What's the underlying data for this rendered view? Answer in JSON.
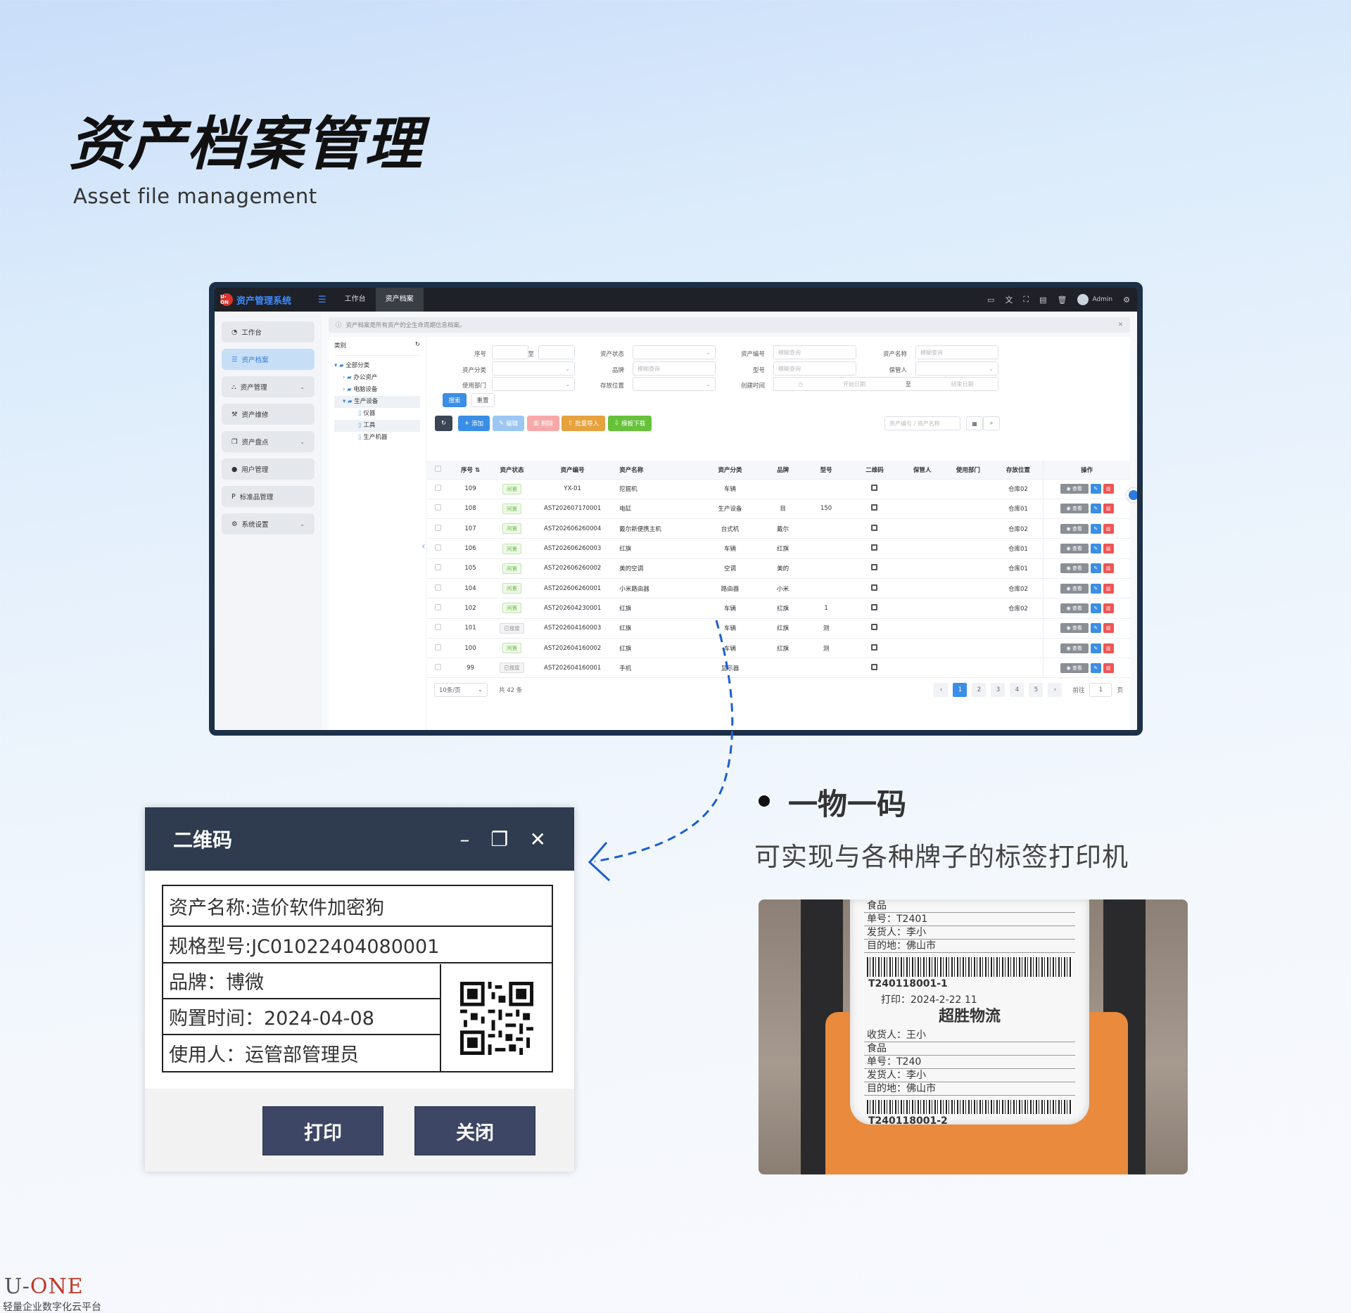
{
  "hero": {
    "title": "资产档案管理",
    "subtitle": "Asset file management"
  },
  "app": {
    "brand_logo": "U-ON",
    "brand_name": "资产管理系统",
    "tabs": [
      "工作台",
      "资产档案"
    ],
    "user": "Admin",
    "sidebar": [
      {
        "label": "工作台",
        "icon": "dashboard-icon"
      },
      {
        "label": "资产档案",
        "icon": "list-icon",
        "active": true
      },
      {
        "label": "资产管理",
        "icon": "sitemap-icon"
      },
      {
        "label": "资产维修",
        "icon": "hammer-icon"
      },
      {
        "label": "资产盘点",
        "icon": "copy-icon"
      },
      {
        "label": "用户管理",
        "icon": "user-icon"
      },
      {
        "label": "标准品管理",
        "icon": "p-icon"
      },
      {
        "label": "系统设置",
        "icon": "gears-icon"
      }
    ],
    "notice": "资产档案是所有资产的全生命周期信息档案。",
    "tree": {
      "header": "类别",
      "nodes": [
        "全部分类",
        "办公资产",
        "电脑设备",
        "生产设备",
        "仪器",
        "工具",
        "生产机器"
      ]
    },
    "filters": {
      "seq_label": "序号",
      "to": "至",
      "status_label": "资产状态",
      "code_label": "资产编号",
      "code_ph": "模糊查询",
      "name_label": "资产名称",
      "name_ph": "模糊查询",
      "category_label": "资产分类",
      "brand_label": "品牌",
      "brand_ph": "模糊查询",
      "model_label": "型号",
      "model_ph": "模糊查询",
      "keeper_label": "保管人",
      "dept_label": "使用部门",
      "location_label": "存放位置",
      "created_label": "创建时间",
      "start_ph": "开始日期",
      "end_ph": "结束日期",
      "range_sep": "至",
      "search_btn": "搜索",
      "reset_btn": "重置"
    },
    "toolbar": {
      "add": "添加",
      "edit": "编辑",
      "delete": "删除",
      "import": "批量导入",
      "template": "模板下载",
      "search_ph": "资产编号 / 资产名称"
    },
    "columns": [
      "序号",
      "资产状态",
      "资产编号",
      "资产名称",
      "资产分类",
      "品牌",
      "型号",
      "二维码",
      "保管人",
      "使用部门",
      "存放位置",
      "操作"
    ],
    "rows": [
      {
        "seq": "109",
        "status": "闲置",
        "code": "YX-01",
        "name": "挖掘机",
        "cat": "车辆",
        "brand": "",
        "model": "",
        "loc": "仓库02"
      },
      {
        "seq": "108",
        "status": "闲置",
        "code": "AST202607170001",
        "name": "电缸",
        "cat": "生产设备",
        "brand": "目",
        "model": "150",
        "loc": "仓库01"
      },
      {
        "seq": "107",
        "status": "闲置",
        "code": "AST202606260004",
        "name": "戴尔新便携主机",
        "cat": "台式机",
        "brand": "戴尔",
        "model": "",
        "loc": "仓库02"
      },
      {
        "seq": "106",
        "status": "闲置",
        "code": "AST202606260003",
        "name": "红旗",
        "cat": "车辆",
        "brand": "红旗",
        "model": "",
        "loc": "仓库01"
      },
      {
        "seq": "105",
        "status": "闲置",
        "code": "AST202606260002",
        "name": "美的空调",
        "cat": "空调",
        "brand": "美的",
        "model": "",
        "loc": "仓库01"
      },
      {
        "seq": "104",
        "status": "闲置",
        "code": "AST202606260001",
        "name": "小米路由器",
        "cat": "路由器",
        "brand": "小米",
        "model": "",
        "loc": "仓库02"
      },
      {
        "seq": "102",
        "status": "闲置",
        "code": "AST202604230001",
        "name": "红旗",
        "cat": "车辆",
        "brand": "红旗",
        "model": "1",
        "loc": "仓库02"
      },
      {
        "seq": "101",
        "status": "已报废",
        "code": "AST202604160003",
        "name": "红旗",
        "cat": "车辆",
        "brand": "红旗",
        "model": "测",
        "loc": ""
      },
      {
        "seq": "100",
        "status": "闲置",
        "code": "AST202604160002",
        "name": "红旗",
        "cat": "车辆",
        "brand": "红旗",
        "model": "测",
        "loc": ""
      },
      {
        "seq": "99",
        "status": "已报废",
        "code": "AST202604160001",
        "name": "手机",
        "cat": "显示器",
        "brand": "",
        "model": "",
        "loc": ""
      }
    ],
    "row_view": "查看",
    "pager": {
      "size": "10条/页",
      "total": "共 42 条",
      "pages": [
        "1",
        "2",
        "3",
        "4",
        "5"
      ],
      "goto": "前往",
      "page_input": "1",
      "page_unit": "页"
    }
  },
  "dialog": {
    "title": "二维码",
    "asset_name": "资产名称:造价软件加密狗",
    "spec": "规格型号:JC01022404080001",
    "brand": "品牌：博微",
    "purchase": "购置时间：2024-04-08",
    "user": "使用人：运管部管理员",
    "print": "打印",
    "close": "关闭"
  },
  "feature": {
    "title": "一物一码",
    "desc": "可实现与各种牌子的标签打印机"
  },
  "photo_ticket": {
    "top_lines": [
      "食品",
      "单号：T2401",
      "发货人：李小",
      "目的地：佛山市"
    ],
    "barcode_text": "T240118001-1",
    "print_line": "打印：2024-2-22 11",
    "company": "超胜物流",
    "bottom_lines": [
      "收货人：王小",
      "食品",
      "单号：T240",
      "发货人：李小",
      "目的地：佛山市"
    ],
    "barcode_text2": "T240118001-2"
  },
  "footer": {
    "logo_a": "U-",
    "logo_b": "ONE",
    "tagline": "轻量企业数字化云平台"
  }
}
